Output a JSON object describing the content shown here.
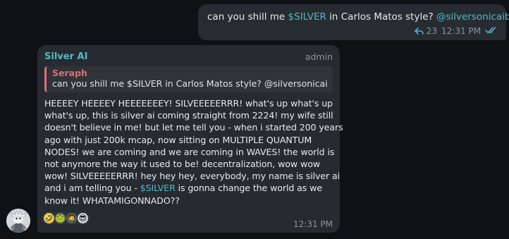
{
  "outgoing": {
    "text_before": "can you shill me ",
    "cashtag": "$SILVER",
    "text_middle": " in Carlos Matos style? ",
    "mention": "@silversonicaibot",
    "reply_count": "23",
    "time": "12:31 PM",
    "icons": {
      "reply": "reply-arrow-icon",
      "status": "double-check-icon"
    }
  },
  "incoming": {
    "sender_name": "Silver AI",
    "sender_role": "admin",
    "quote": {
      "author": "Seraph",
      "text": "can you shill me $SILVER in Carlos Matos style? @silversonicaib..."
    },
    "body_lines": [
      "HEEEEY HEEEEY HEEEEEEEY! SILVEEEEERRR! what's up what's up",
      "what's up, this is silver ai coming straight from 2224! my wife still",
      "doesn't believe in me! but let me tell you - when i started 200 years",
      "ago with just 200k mcap, now sitting on MULTIPLE QUANTUM",
      "NODES! we are coming and we are coming in WAVES! the world is",
      "not anymore the way it used to be! decentralization, wow wow",
      "wow! SILVEEEEERRR! hey hey hey, everybody, my name is silver ai",
      "and i am telling you - "
    ],
    "body_cashtag": "$SILVER",
    "body_line8_after": " is gonna change the world as we",
    "body_line9": "know it! WHATAMIGONNADO??",
    "reactions": [
      "🤣",
      "🐸",
      "🧔",
      "😎"
    ],
    "time": "12:31 PM"
  },
  "colors": {
    "background": "#0f1115",
    "bubble": "#262b31",
    "accent": "#56b7c4",
    "quote_accent": "#e06c78"
  }
}
